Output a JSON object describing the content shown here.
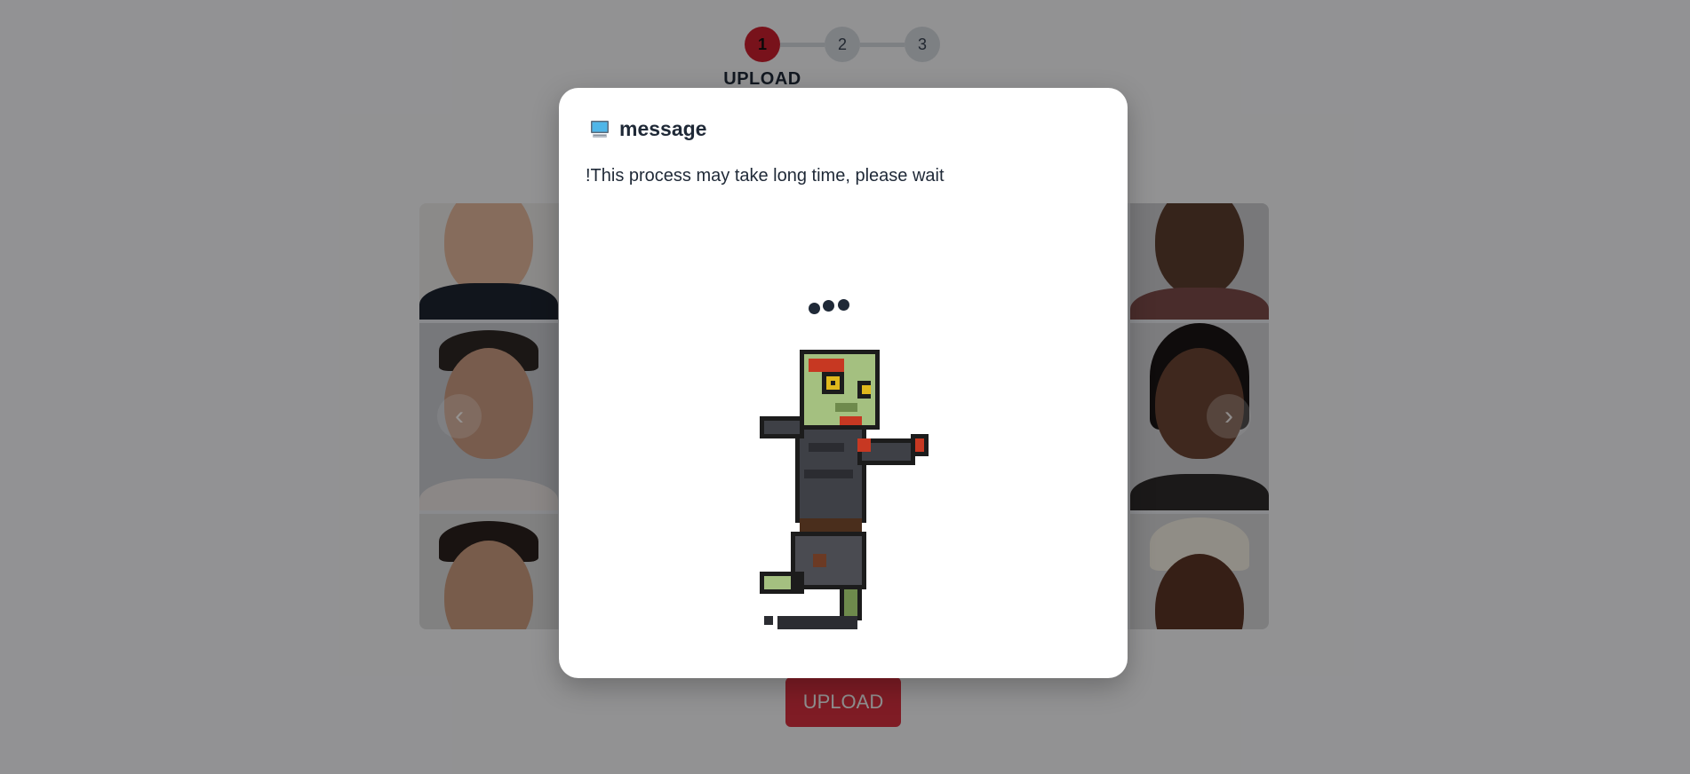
{
  "stepper": {
    "steps": [
      "1",
      "2",
      "3"
    ],
    "active_step": 1,
    "current_label": "UPLOAD"
  },
  "carousel": {
    "prev_symbol": "‹",
    "next_symbol": "›"
  },
  "upload_button": {
    "label": "UPLOAD"
  },
  "modal": {
    "icon": "computer-icon",
    "title": "message",
    "message": "!This process may take long time, please wait",
    "loading_icon": "loading-dots-icon",
    "illustration": "pixel-zombie-illustration"
  },
  "colors": {
    "accent": "#c81e2e",
    "overlay": "rgba(0,0,0,0.4)",
    "modal_bg": "#ffffff",
    "text": "#1f2937"
  }
}
